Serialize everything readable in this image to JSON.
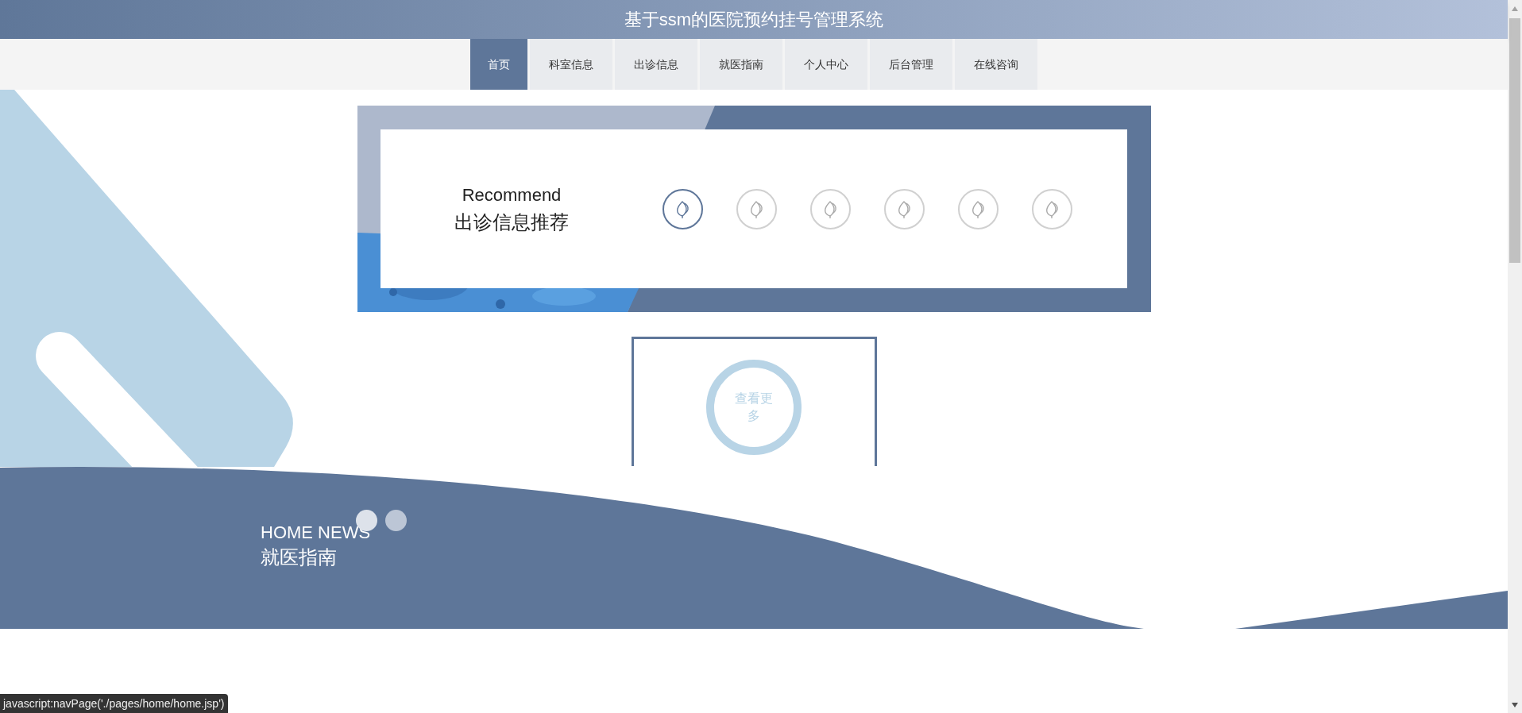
{
  "header": {
    "title": "基于ssm的医院预约挂号管理系统"
  },
  "nav": [
    {
      "label": "首页",
      "selected": true
    },
    {
      "label": "科室信息",
      "selected": false
    },
    {
      "label": "出诊信息",
      "selected": false
    },
    {
      "label": "就医指南",
      "selected": false
    },
    {
      "label": "个人中心",
      "selected": false
    },
    {
      "label": "后台管理",
      "selected": false
    },
    {
      "label": "在线咨询",
      "selected": false
    }
  ],
  "recommend": {
    "title_en": "Recommend",
    "title_cn": "出诊信息推荐",
    "indicators": [
      {
        "selected": true
      },
      {
        "selected": false
      },
      {
        "selected": false
      },
      {
        "selected": false
      },
      {
        "selected": false
      },
      {
        "selected": false
      }
    ]
  },
  "more_button": {
    "label": "查看更多"
  },
  "news": {
    "title_en": "HOME NEWS",
    "title_cn": "就医指南",
    "dots": [
      {
        "selected": true
      },
      {
        "selected": false
      }
    ]
  },
  "status_bar": {
    "text": "javascript:navPage('./pages/home/home.jsp')"
  }
}
